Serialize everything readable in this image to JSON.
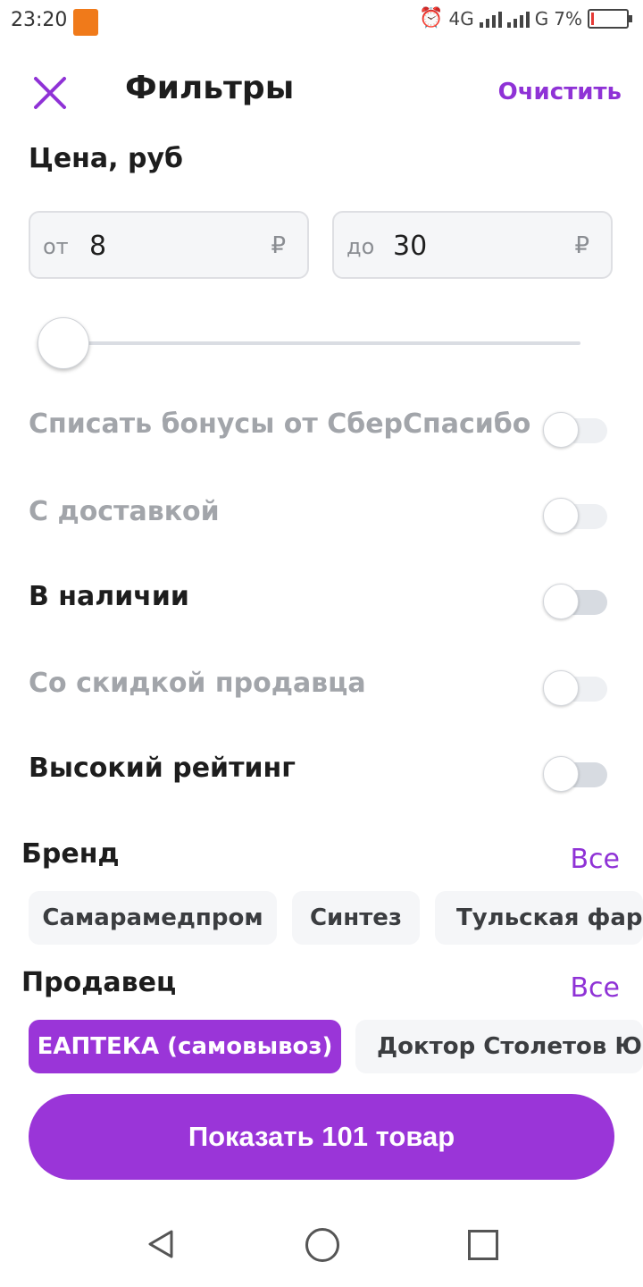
{
  "status_bar": {
    "time": "23:20",
    "net1_label": "4G",
    "net2_label": "G",
    "battery_text": "7%"
  },
  "header": {
    "title": "Фильтры",
    "clear_label": "Очистить"
  },
  "price": {
    "label": "Цена, руб",
    "from_prefix": "от",
    "from_value": "8",
    "to_prefix": "до",
    "to_value": "30",
    "currency": "₽",
    "slider_level": 0
  },
  "options": [
    {
      "label": "Списать бонусы от СберСпасибо",
      "enabled": false,
      "on": false
    },
    {
      "label": "С доставкой",
      "enabled": false,
      "on": false
    },
    {
      "label": "В наличии",
      "enabled": true,
      "on": false
    },
    {
      "label": "Со скидкой продавца",
      "enabled": false,
      "on": false
    },
    {
      "label": "Высокий рейтинг",
      "enabled": true,
      "on": false
    }
  ],
  "brand": {
    "label": "Бренд",
    "all_label": "Все",
    "chips": [
      "Самарамедпром",
      "Синтез",
      "Тульская фарма"
    ]
  },
  "seller": {
    "label": "Продавец",
    "all_label": "Все",
    "chips": [
      "ЕАПТЕКА (самовывоз)",
      "Доктор Столетов Юг"
    ],
    "selected_index": 0
  },
  "cta": {
    "label": "Показать 101 товар"
  },
  "colors": {
    "accent": "#9a35d8",
    "link": "#8f32d6",
    "dim_text": "#a2a5aa"
  }
}
